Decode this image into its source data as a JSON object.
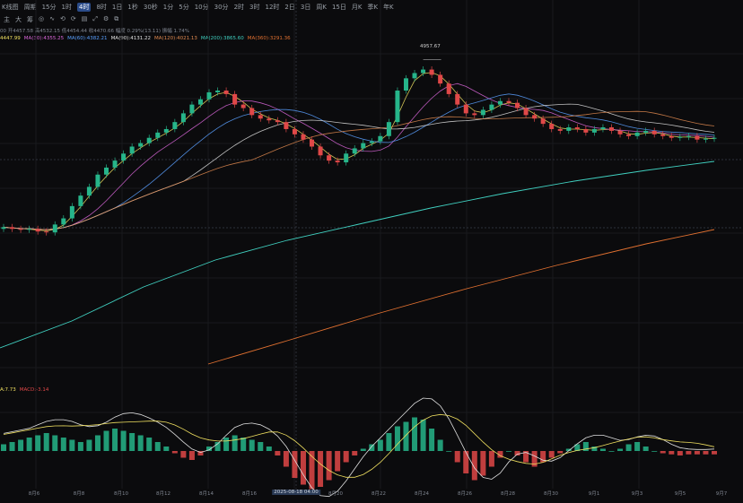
{
  "toolbar": {
    "items": [
      "K线图",
      "周期",
      "15分",
      "1时",
      "4时",
      "8时",
      "1日",
      "1秒",
      "30秒",
      "1分",
      "5分",
      "10分",
      "30分",
      "2时",
      "3时",
      "12时",
      "2日",
      "3日",
      "周K",
      "15日",
      "月K",
      "季K",
      "年K"
    ],
    "active_index": 4
  },
  "icons": [
    "chart-type-icon",
    "indicator-icon",
    "draw-icon",
    "settings-icon",
    "fullscreen-icon",
    "snapshot-icon",
    "layout-icon",
    "more-icon",
    "undo-icon",
    "redo-icon",
    "delete-icon"
  ],
  "icon_glyphs": [
    "主",
    "大",
    "筹",
    "◎",
    "∿",
    "⟲",
    "⟳",
    "▤",
    "⤢",
    "⚙",
    "⧉"
  ],
  "info_line": "00  开4457.58  高4532.15  低4454.44  收4470.66  幅度 0.29%(13.11)  振幅 1.74%",
  "ma_line": [
    {
      "label": "4447.99",
      "color": "#f0e060"
    },
    {
      "label": "MA(30):4355.25",
      "color": "#d966d9"
    },
    {
      "label": "MA(60):4382.21",
      "color": "#5aa0ff"
    },
    {
      "label": "MA(90):4131.22",
      "color": "#e0e0e0"
    },
    {
      "label": "MA(120):4021.13",
      "color": "#e08a50"
    },
    {
      "label": "MA(200):3865.60",
      "color": "#40d0c0"
    },
    {
      "label": "MA(360):3291.36",
      "color": "#e07030"
    }
  ],
  "macd_line": [
    {
      "label": "A:7.73",
      "color": "#f0e060"
    },
    {
      "label": "MACD:-3.14",
      "color": "#e04848"
    }
  ],
  "peak_label": "4957.67",
  "crosshair_time": "2025-08-18 04:00",
  "x_labels": [
    "8月6",
    "8月8",
    "8月10",
    "8月12",
    "8月14",
    "8月16",
    "8月20",
    "8月22",
    "8月24",
    "8月26",
    "8月28",
    "8月30",
    "9月1",
    "9月3",
    "9月5",
    "9月7"
  ],
  "colors": {
    "up": "#26b58a",
    "down": "#e04848",
    "background": "#0b0b0d"
  },
  "chart_data": {
    "type": "candlestick",
    "interval": "4h",
    "price_range": [
      3300,
      4990
    ],
    "close_path": [
      4000,
      3990,
      3985,
      3990,
      3975,
      3970,
      4015,
      4050,
      4120,
      4180,
      4230,
      4300,
      4340,
      4380,
      4420,
      4460,
      4480,
      4510,
      4540,
      4560,
      4600,
      4650,
      4700,
      4730,
      4770,
      4780,
      4760,
      4700,
      4680,
      4640,
      4620,
      4610,
      4600,
      4560,
      4530,
      4500,
      4460,
      4410,
      4380,
      4370,
      4420,
      4450,
      4480,
      4490,
      4520,
      4600,
      4780,
      4850,
      4880,
      4900,
      4870,
      4820,
      4760,
      4700,
      4650,
      4640,
      4670,
      4700,
      4720,
      4710,
      4680,
      4640,
      4620,
      4590,
      4560,
      4550,
      4570,
      4560,
      4540,
      4560,
      4570,
      4550,
      4530,
      4520,
      4540,
      4550,
      4530,
      4520,
      4510,
      4515,
      4520,
      4500,
      4505,
      4510
    ],
    "macd": {
      "hist": [
        6,
        8,
        10,
        12,
        14,
        16,
        14,
        12,
        10,
        8,
        10,
        14,
        18,
        20,
        18,
        16,
        14,
        12,
        8,
        4,
        -2,
        -6,
        -8,
        -4,
        4,
        8,
        12,
        14,
        12,
        10,
        8,
        4,
        -4,
        -14,
        -24,
        -30,
        -34,
        -32,
        -26,
        -18,
        -10,
        -4,
        2,
        6,
        10,
        16,
        22,
        26,
        30,
        28,
        20,
        10,
        0,
        -10,
        -20,
        -26,
        -22,
        -14,
        -6,
        0,
        -4,
        -10,
        -14,
        -10,
        -6,
        -2,
        2,
        6,
        8,
        4,
        2,
        0,
        2,
        6,
        8,
        4,
        0,
        -2,
        -3,
        -4,
        -3,
        -3,
        -3,
        -3
      ]
    }
  }
}
